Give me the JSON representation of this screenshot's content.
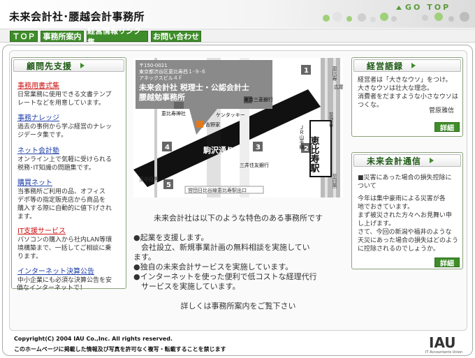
{
  "header": {
    "site_title": "未来会計社･腰越会計事務所",
    "gotop_label": "GO TOP"
  },
  "nav": {
    "items": [
      {
        "label": "ＴＯＰ"
      },
      {
        "label": "事務所案内"
      },
      {
        "label": "経営情報リンク集"
      },
      {
        "label": "お問い合わせ"
      }
    ]
  },
  "left_panel": {
    "title": "顧問先支援",
    "services": [
      {
        "title": "事務用書式集",
        "color": "red",
        "desc": [
          "日常業務に使用できる文書テンプ",
          "レートなどを用意しています。"
        ]
      },
      {
        "title": "事務ナレッジ",
        "color": "blue",
        "desc": [
          "過去の事例から学ぶ経営のナレッ",
          "ジデータ集です。"
        ]
      },
      {
        "title": "ネット会計塾",
        "color": "blue",
        "desc": [
          "オンライン上で気軽に受けられる",
          "税務･IT知識の問題集です。"
        ]
      },
      {
        "title": "購買ネット",
        "color": "blue",
        "desc": [
          "当事務所ご利用の品、オフィス",
          "デポ等の指定販売店から商品を",
          "購入する際に自動的に値下げされ",
          "ます。"
        ]
      },
      {
        "title": "IT支援サービス",
        "color": "red",
        "desc": [
          "パソコンの購入から社内LAN等環",
          "境構築まで、一括してご相談に乗",
          "ります。"
        ]
      },
      {
        "title": "インターネット決算公告",
        "color": "blue",
        "desc": [
          "中小企業にも必須な決算公告を安",
          "価なインターネットで！"
        ]
      }
    ]
  },
  "map": {
    "address_lines": [
      "〒150-0021",
      "東京都渋谷区恵比寿西１-９-６",
      "アネックスビル４Ｆ"
    ],
    "office_name_1": "未来会計社 税理士・公認会計士",
    "office_name_2": "腰越勉事務所",
    "labels": {
      "shrine": "恵比寿神社",
      "kfc": "ケンタッキー",
      "yoshinoya": "吉野家",
      "bank_tokyo": "東京三菱銀行",
      "bank_mitsui": "三井住友銀行",
      "komazawa": "駒沢通り",
      "station": "恵比寿駅",
      "jr_line": "ＪＲ山手線",
      "exit": "営団日比谷線恵比寿駅出口",
      "ebisu_n": "恵比寿",
      "hiroo": "広尾",
      "shibuya": "至渋谷",
      "nakameguro": "至中目黒",
      "meguro": "至目黒",
      "n1": "1",
      "n2": "2",
      "n3": "3",
      "n4": "4",
      "n5": "5"
    }
  },
  "center": {
    "intro": "未来会計社は以下のような特色のある事務所です",
    "bullets": [
      [
        "●起業を支援します。",
        "　会社設立、新規事業計画の無料相談を実施してい",
        "ます。"
      ],
      [
        "●独自の未来会計サービスを実施しています。"
      ],
      [
        "●インターネットを使った便利で低コストな経理代行",
        "　サービスを実施しています。"
      ]
    ],
    "outro": "詳しくは事務所案内をご覧下さい"
  },
  "right_top": {
    "title": "経営語録",
    "lines": [
      "経営者は「大きなウソ」をつけ。",
      "大きなウソは壮大な理念。",
      "消費者をだますような小さなウソは",
      "つくな。"
    ],
    "author": "菅原雅信",
    "button": "詳細"
  },
  "right_bottom": {
    "title": "未来会計通信",
    "lines": [
      "■災害にあった場合の損失控除に",
      "ついて",
      "",
      "今年は集中豪雨による災害が各",
      "地でおきています。",
      "まず被災された方々へお見舞い申",
      "し上げます。",
      "さて、今回の新潟や福井のような",
      "天災にあった場合の損失はどのよう",
      "に控除されるのでしょうか。"
    ],
    "button": "詳細"
  },
  "footer": {
    "copyright": "Copyright(C) 2004 IAU Co.,Inc. All rights reserved.",
    "notice": "このホームページに掲載した情報及び写真を許可なく複写・転載することを禁じます",
    "logo_text": "IAU",
    "logo_sub": "IT Accountants Union"
  },
  "colors": {
    "accent": "#3f8d2a",
    "link_red": "#cc1111",
    "link_blue": "#1c3ea8"
  }
}
